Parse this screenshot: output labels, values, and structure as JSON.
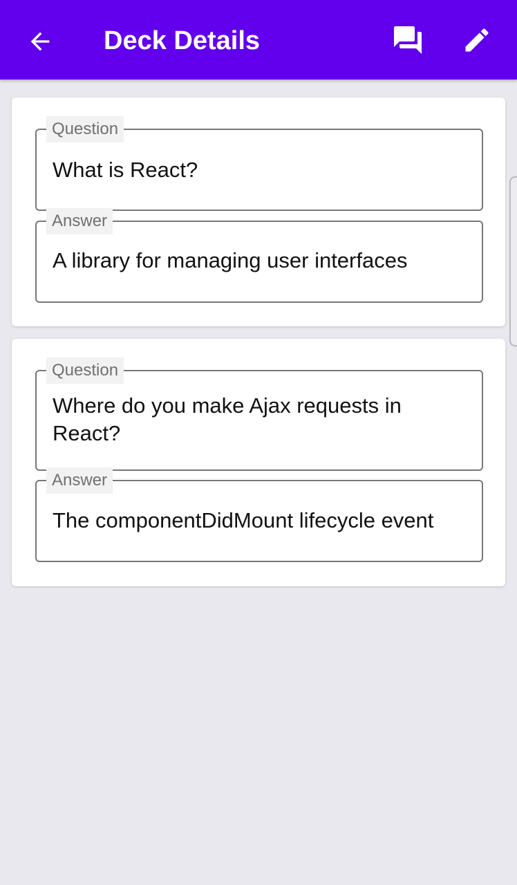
{
  "header": {
    "title": "Deck Details",
    "back_icon": "arrow-back-icon",
    "cards_icon": "forum-icon",
    "edit_icon": "edit-pencil-icon",
    "background": "#6200ee"
  },
  "cards": [
    {
      "question_label": "Question",
      "question": "What is React?",
      "answer_label": "Answer",
      "answer": "A library for managing user interfaces"
    },
    {
      "question_label": "Question",
      "question": "Where do you make Ajax requests in React?",
      "answer_label": "Answer",
      "answer": "The componentDidMount lifecycle event"
    }
  ]
}
